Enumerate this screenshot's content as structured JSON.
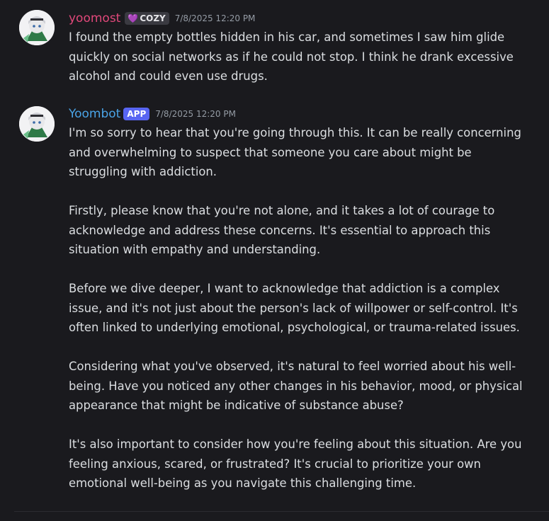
{
  "messages": [
    {
      "username": "yoomost",
      "username_color": "#e0487a",
      "badge": {
        "icon": "heart-icon",
        "label": "COZY"
      },
      "timestamp": "7/8/2025 12:20 PM",
      "paragraphs": [
        "I found the empty bottles hidden in his car, and sometimes I saw him glide quickly on social networks as if he could not stop. I think he drank excessive alcohol and could even use drugs."
      ]
    },
    {
      "username": "Yoombot",
      "username_color": "#4aa3e6",
      "badge": {
        "label": "APP"
      },
      "timestamp": "7/8/2025 12:20 PM",
      "paragraphs": [
        "I'm so sorry to hear that you're going through this. It can be really concerning and overwhelming to suspect that someone you care about might be struggling with addiction.",
        "Firstly, please know that you're not alone, and it takes a lot of courage to acknowledge and address these concerns. It's essential to approach this situation with empathy and understanding.",
        "Before we dive deeper, I want to acknowledge that addiction is a complex issue, and it's not just about the person's lack of willpower or self-control. It's often linked to underlying emotional, psychological, or trauma-related issues.",
        "Considering what you've observed, it's natural to feel worried about his well-being. Have you noticed any other changes in his behavior, mood, or physical appearance that might be indicative of substance abuse?",
        "It's also important to consider how you're feeling about this situation. Are you feeling anxious, scared, or frustrated? It's crucial to prioritize your own emotional well-being as you navigate this challenging time."
      ]
    }
  ]
}
